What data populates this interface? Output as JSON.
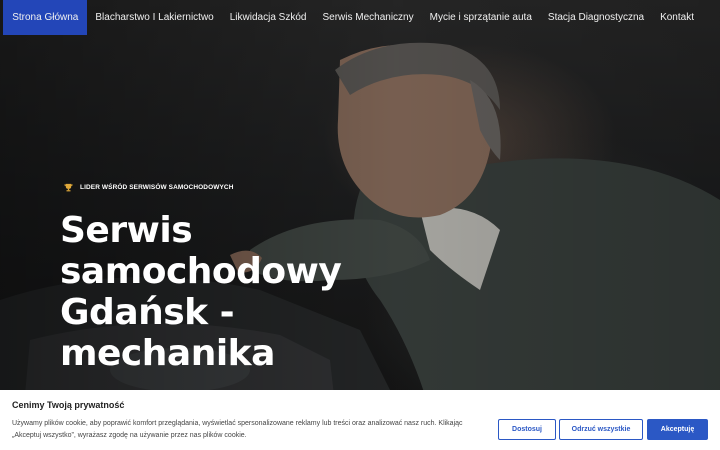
{
  "colors": {
    "accent": "#2346b8",
    "cookie_button": "#2b58c5"
  },
  "nav": {
    "items": [
      {
        "label": "Strona Główna"
      },
      {
        "label": "Blacharstwo I Lakiernictwo"
      },
      {
        "label": "Likwidacja Szkód"
      },
      {
        "label": "Serwis Mechaniczny"
      },
      {
        "label": "Mycie i sprzątanie auta"
      },
      {
        "label": "Stacja Diagnostyczna"
      },
      {
        "label": "Kontakt"
      }
    ]
  },
  "hero": {
    "badge_icon": "trophy-icon",
    "badge": "LIDER WŚRÓD SERWISÓW SAMOCHODOWYCH",
    "headline_lines": [
      "Serwis",
      "samochodowy",
      "Gdańsk -",
      "mechanika"
    ]
  },
  "cookie": {
    "title": "Cenimy Twoją prywatność",
    "text": "Używamy plików cookie, aby poprawić komfort przeglądania, wyświetlać spersonalizowane reklamy lub treści oraz analizować nasz ruch. Klikając „Akceptuj wszystko”, wyrażasz zgodę na używanie przez nas plików cookie.",
    "buttons": {
      "customize": "Dostosuj",
      "reject": "Odrzuć wszystkie",
      "accept": "Akceptuję"
    }
  }
}
